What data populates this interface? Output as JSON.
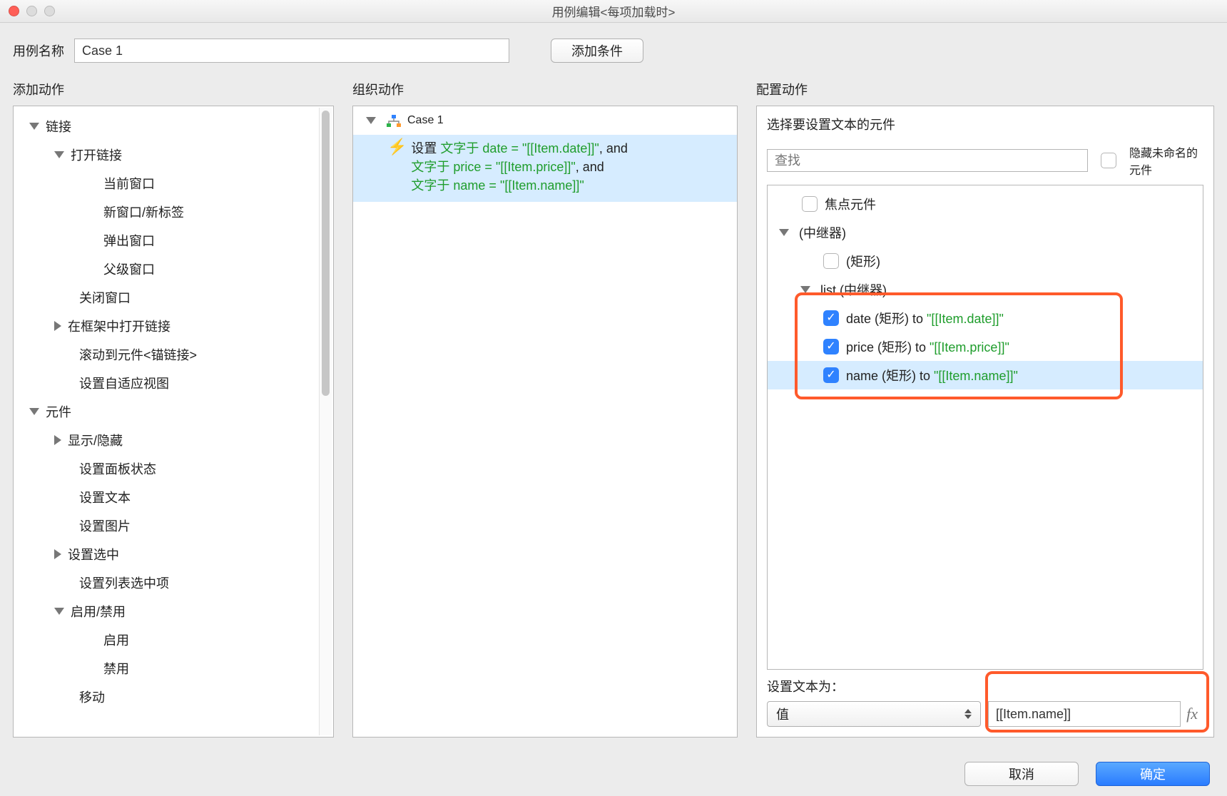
{
  "titlebar": {
    "title": "用例编辑<每项加载时>"
  },
  "toprow": {
    "case_name_label": "用例名称",
    "case_name_value": "Case 1",
    "add_condition_label": "添加条件"
  },
  "headings": {
    "add_action": "添加动作",
    "organize_action": "组织动作",
    "configure_action": "配置动作"
  },
  "left_tree": {
    "link_group": "链接",
    "open_link": "打开链接",
    "open_link_children": [
      "当前窗口",
      "新窗口/新标签",
      "弹出窗口",
      "父级窗口"
    ],
    "close_window": "关闭窗口",
    "open_in_frame": "在框架中打开链接",
    "scroll_anchor": "滚动到元件<锚链接>",
    "set_adaptive": "设置自适应视图",
    "widget_group": "元件",
    "show_hide": "显示/隐藏",
    "set_panel_state": "设置面板状态",
    "set_text": "设置文本",
    "set_image": "设置图片",
    "set_selected": "设置选中",
    "set_list_selected": "设置列表选中项",
    "enable_disable": "启用/禁用",
    "enable": "启用",
    "disable": "禁用",
    "move": "移动"
  },
  "mid": {
    "case_label": "Case 1",
    "action_set": "设置",
    "pre1": "文字于 date = ",
    "val1": "\"[[Item.date]]\"",
    "and": ", and",
    "pre2": "文字于 price = ",
    "val2": "\"[[Item.price]]\"",
    "pre3": "文字于 name = ",
    "val3": "\"[[Item.name]]\""
  },
  "right": {
    "select_widget_title": "选择要设置文本的元件",
    "search_placeholder": "查找",
    "hide_unnamed_label": "隐藏未命名的元件",
    "focus_widget": "焦点元件",
    "repeater_parent": "(中继器)",
    "rect_unnamed": "(矩形)",
    "list_repeater": "list (中继器)",
    "items": [
      {
        "label_a": "date (矩形) to ",
        "label_b": "\"[[Item.date]]\""
      },
      {
        "label_a": "price (矩形) to ",
        "label_b": "\"[[Item.price]]\""
      },
      {
        "label_a": "name (矩形) to ",
        "label_b": "\"[[Item.name]]\""
      }
    ],
    "set_text_as": "设置文本为：",
    "value_select": "值",
    "fx_value": "[[Item.name]]",
    "fx_symbol": "fx"
  },
  "footer": {
    "cancel": "取消",
    "ok": "确定"
  }
}
